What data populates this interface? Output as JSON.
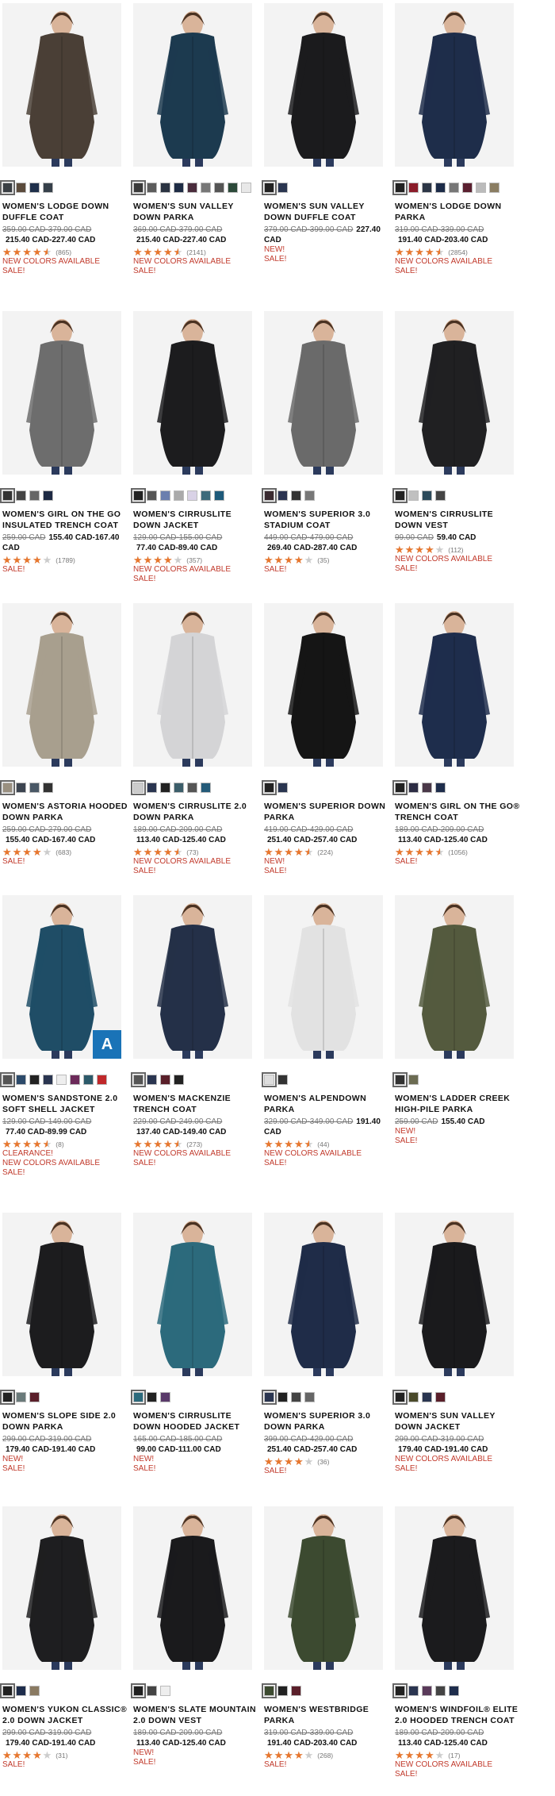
{
  "products": [
    {
      "name": "WOMEN'S LODGE DOWN DUFFLE COAT",
      "was": "359.00 CAD-379.00 CAD",
      "now": "215.40 CAD-227.40 CAD",
      "rating": 4.5,
      "reviews": "(865)",
      "flags": [
        "NEW COLORS AVAILABLE",
        "SALE!"
      ],
      "coat": "#4a3f36",
      "swatches": [
        "#3a3f44",
        "#5b4b3c",
        "#1f2f4a",
        "#36404a"
      ]
    },
    {
      "name": "WOMEN'S SUN VALLEY DOWN PARKA",
      "was": "369.00 CAD-379.00 CAD",
      "now": "215.40 CAD-227.40 CAD",
      "rating": 4.5,
      "reviews": "(2141)",
      "flags": [
        "NEW COLORS AVAILABLE",
        "SALE!"
      ],
      "coat": "#1c3a4f",
      "swatches": [
        "#3a3a3a",
        "#5c5c5c",
        "#2b3442",
        "#1e2c45",
        "#4a2c3c",
        "#777",
        "#555",
        "#2c4a3a",
        "#e8e8e8"
      ]
    },
    {
      "name": "WOMEN'S SUN VALLEY DOWN DUFFLE COAT",
      "was": "379.00 CAD-399.00 CAD",
      "now": "227.40 CAD",
      "rating": 0,
      "reviews": "",
      "flags": [
        "NEW!",
        "SALE!"
      ],
      "coat": "#1b1b1d",
      "swatches": [
        "#222",
        "#2a3550"
      ]
    },
    {
      "name": "WOMEN'S LODGE DOWN PARKA",
      "was": "319.00 CAD-339.00 CAD",
      "now": "191.40 CAD-203.40 CAD",
      "rating": 4.5,
      "reviews": "(2854)",
      "flags": [
        "NEW COLORS AVAILABLE",
        "SALE!"
      ],
      "coat": "#1e2d4a",
      "swatches": [
        "#222",
        "#8b1c2a",
        "#2c3646",
        "#1c2b48",
        "#777",
        "#5a1f2f",
        "#bbb",
        "#8a7d62"
      ]
    },
    {
      "name": "WOMEN'S GIRL ON THE GO INSULATED TRENCH COAT",
      "was": "259.00 CAD",
      "now": "155.40 CAD-167.40 CAD",
      "rating": 4,
      "reviews": "(1789)",
      "flags": [
        "SALE!"
      ],
      "coat": "#6d6d6d",
      "swatches": [
        "#333",
        "#444",
        "#666",
        "#1e2a44"
      ]
    },
    {
      "name": "WOMEN'S CIRRUSLITE DOWN JACKET",
      "was": "129.00 CAD-155.00 CAD",
      "now": "77.40 CAD-89.40 CAD",
      "rating": 4,
      "reviews": "(357)",
      "flags": [
        "NEW COLORS AVAILABLE",
        "SALE!"
      ],
      "coat": "#1c1c1e",
      "swatches": [
        "#222",
        "#555",
        "#6b7fae",
        "#aaa",
        "#d9d2e6",
        "#3e6a7a",
        "#1e5a7a"
      ]
    },
    {
      "name": "WOMEN'S SUPERIOR 3.0 STADIUM COAT",
      "was": "449.00 CAD-479.00 CAD",
      "now": "269.40 CAD-287.40 CAD",
      "rating": 4,
      "reviews": "(35)",
      "flags": [
        "SALE!"
      ],
      "coat": "#6a6a6a",
      "swatches": [
        "#3a2a30",
        "#2a3350",
        "#333",
        "#777"
      ]
    },
    {
      "name": "WOMEN'S CIRRUSLITE DOWN VEST",
      "was": "99.00 CAD",
      "now": "59.40 CAD",
      "rating": 4,
      "reviews": "(112)",
      "flags": [
        "NEW COLORS AVAILABLE",
        "SALE!"
      ],
      "coat": "#202022",
      "swatches": [
        "#222",
        "#c0c0c0",
        "#2c4a5a",
        "#444"
      ]
    },
    {
      "name": "WOMEN'S ASTORIA HOODED DOWN PARKA",
      "was": "259.00 CAD-279.00 CAD",
      "now": "155.40 CAD-167.40 CAD",
      "rating": 4,
      "reviews": "(683)",
      "flags": [
        "SALE!"
      ],
      "coat": "#a89f8e",
      "swatches": [
        "#9a9080",
        "#3c4450",
        "#4a5866",
        "#333"
      ]
    },
    {
      "name": "WOMEN'S CIRRUSLITE 2.0 DOWN PARKA",
      "was": "189.00 CAD-209.00 CAD",
      "now": "113.40 CAD-125.40 CAD",
      "rating": 4.5,
      "reviews": "(73)",
      "flags": [
        "NEW COLORS AVAILABLE",
        "SALE!"
      ],
      "coat": "#d4d4d6",
      "swatches": [
        "#ccc",
        "#2a3550",
        "#222",
        "#3c5e6a",
        "#555",
        "#245a78"
      ]
    },
    {
      "name": "WOMEN'S SUPERIOR DOWN PARKA",
      "was": "419.00 CAD-429.00 CAD",
      "now": "251.40 CAD-257.40 CAD",
      "rating": 4.5,
      "reviews": "(224)",
      "flags": [
        "NEW!",
        "SALE!"
      ],
      "coat": "#151515",
      "swatches": [
        "#222",
        "#2a3550"
      ]
    },
    {
      "name": "WOMEN'S GIRL ON THE GO® TRENCH COAT",
      "was": "189.00 CAD-209.00 CAD",
      "now": "113.40 CAD-125.40 CAD",
      "rating": 4.5,
      "reviews": "(1056)",
      "flags": [
        "SALE!"
      ],
      "coat": "#1e2d4c",
      "swatches": [
        "#222",
        "#2c2c44",
        "#4a3848",
        "#1e2d4c"
      ]
    },
    {
      "name": "WOMEN'S SANDSTONE 2.0 SOFT SHELL JACKET",
      "was": "129.00 CAD-149.00 CAD",
      "now": "77.40 CAD-89.99 CAD",
      "rating": 4.5,
      "reviews": "(8)",
      "flags": [
        "CLEARANCE!",
        "NEW COLORS AVAILABLE",
        "SALE!"
      ],
      "coat": "#1f4d66",
      "swatches": [
        "#555",
        "#2c4a6a",
        "#222",
        "#2a3550",
        "#eee",
        "#6c2a5a",
        "#2c5a6a",
        "#c0282a"
      ],
      "badge": "A"
    },
    {
      "name": "WOMEN'S MACKENZIE TRENCH COAT",
      "was": "229.00 CAD-249.00 CAD",
      "now": "137.40 CAD-149.40 CAD",
      "rating": 4.5,
      "reviews": "(273)",
      "flags": [
        "NEW COLORS AVAILABLE",
        "SALE!"
      ],
      "coat": "#243048",
      "swatches": [
        "#555",
        "#2a3550",
        "#5a1f2a",
        "#222"
      ]
    },
    {
      "name": "WOMEN'S ALPENDOWN PARKA",
      "was": "329.00 CAD-349.00 CAD",
      "now": "191.40 CAD",
      "rating": 4.5,
      "reviews": "(44)",
      "flags": [
        "NEW COLORS AVAILABLE",
        "SALE!"
      ],
      "coat": "#e2e2e2",
      "swatches": [
        "#ddd",
        "#333"
      ]
    },
    {
      "name": "WOMEN'S LADDER CREEK HIGH-PILE PARKA",
      "was": "259.00 CAD",
      "now": "155.40 CAD",
      "rating": 0,
      "reviews": "",
      "flags": [
        "NEW!",
        "SALE!"
      ],
      "coat": "#545a3e",
      "swatches": [
        "#333",
        "#6b6b52"
      ]
    },
    {
      "name": "WOMEN'S SLOPE SIDE 2.0 DOWN PARKA",
      "was": "299.00 CAD-319.00 CAD",
      "now": "179.40 CAD-191.40 CAD",
      "rating": 0,
      "reviews": "",
      "flags": [
        "NEW!",
        "SALE!"
      ],
      "coat": "#1c1c1e",
      "swatches": [
        "#222",
        "#6a7a7a",
        "#5a1f2a"
      ]
    },
    {
      "name": "WOMEN'S CIRRUSLITE DOWN HOODED JACKET",
      "was": "165.00 CAD-185.00 CAD",
      "now": "99.00 CAD-111.00 CAD",
      "rating": 0,
      "reviews": "",
      "flags": [
        "NEW!",
        "SALE!"
      ],
      "coat": "#2c6a7c",
      "swatches": [
        "#2c6a7c",
        "#222",
        "#5a3a6a"
      ]
    },
    {
      "name": "WOMEN'S SUPERIOR 3.0 DOWN PARKA",
      "was": "399.00 CAD-429.00 CAD",
      "now": "251.40 CAD-257.40 CAD",
      "rating": 4,
      "reviews": "(36)",
      "flags": [
        "SALE!"
      ],
      "coat": "#1f2c48",
      "swatches": [
        "#2a3550",
        "#222",
        "#444",
        "#666"
      ]
    },
    {
      "name": "WOMEN'S SUN VALLEY DOWN JACKET",
      "was": "299.00 CAD-319.00 CAD",
      "now": "179.40 CAD-191.40 CAD",
      "rating": 0,
      "reviews": "",
      "flags": [
        "NEW COLORS AVAILABLE",
        "SALE!"
      ],
      "coat": "#1a1a1c",
      "swatches": [
        "#222",
        "#4a4a2a",
        "#2a3550",
        "#5a1f2a"
      ]
    },
    {
      "name": "WOMEN'S YUKON CLASSIC® 2.0 DOWN JACKET",
      "was": "299.00 CAD-319.00 CAD",
      "now": "179.40 CAD-191.40 CAD",
      "rating": 4,
      "reviews": "(31)",
      "flags": [
        "SALE!"
      ],
      "coat": "#1e1e20",
      "swatches": [
        "#222",
        "#1e2d4c",
        "#8a7a62"
      ]
    },
    {
      "name": "WOMEN'S SLATE MOUNTAIN 2.0 DOWN VEST",
      "was": "189.00 CAD-209.00 CAD",
      "now": "113.40 CAD-125.40 CAD",
      "rating": 0,
      "reviews": "",
      "flags": [
        "NEW!",
        "SALE!"
      ],
      "coat": "#1a1a1c",
      "swatches": [
        "#222",
        "#444",
        "#eee"
      ]
    },
    {
      "name": "WOMEN'S WESTBRIDGE PARKA",
      "was": "319.00 CAD-339.00 CAD",
      "now": "191.40 CAD-203.40 CAD",
      "rating": 4,
      "reviews": "(268)",
      "flags": [
        "SALE!"
      ],
      "coat": "#3c4a30",
      "swatches": [
        "#3c4a30",
        "#222",
        "#5a1f2a"
      ]
    },
    {
      "name": "WOMEN'S WINDFOIL® ELITE 2.0 HOODED TRENCH COAT",
      "was": "189.00 CAD-209.00 CAD",
      "now": "113.40 CAD-125.40 CAD",
      "rating": 4,
      "reviews": "(17)",
      "flags": [
        "NEW COLORS AVAILABLE",
        "SALE!"
      ],
      "coat": "#1b1b1d",
      "swatches": [
        "#222",
        "#2a3550",
        "#5a3a5a",
        "#444",
        "#1e2d4c"
      ]
    }
  ],
  "colors": {
    "accent": "#c1392b",
    "star": "#e8772e"
  }
}
